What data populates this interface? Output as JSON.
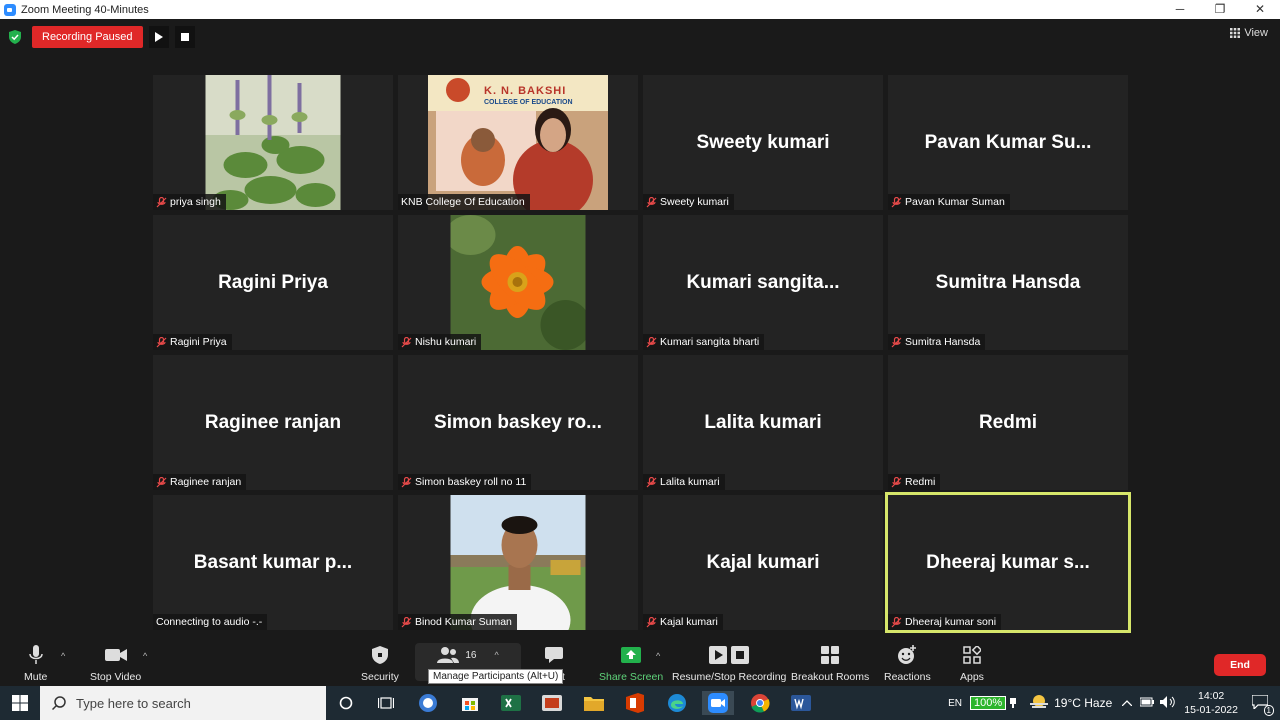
{
  "window": {
    "title": "Zoom Meeting 40-Minutes",
    "controls": [
      "─",
      "❐",
      "✕"
    ]
  },
  "recording": {
    "status": "Recording Paused",
    "resume_icon": "play-icon",
    "stop_icon": "stop-icon"
  },
  "view_button": {
    "label": "View"
  },
  "participants": [
    {
      "display": "",
      "tag": "priya singh",
      "muted": true,
      "media": "tulsi-plant-photo"
    },
    {
      "display": "",
      "tag": "KNB College Of Education",
      "muted": false,
      "media": "video-feed"
    },
    {
      "display": "Sweety kumari",
      "tag": "Sweety kumari",
      "muted": true
    },
    {
      "display": "Pavan Kumar Su...",
      "tag": "Pavan Kumar Suman",
      "muted": true
    },
    {
      "display": "Ragini  Priya",
      "tag": "Ragini  Priya",
      "muted": true
    },
    {
      "display": "",
      "tag": "Nishu kumari",
      "muted": true,
      "media": "orange-flower-photo"
    },
    {
      "display": "Kumari  sangita...",
      "tag": "Kumari sangita bharti",
      "muted": true
    },
    {
      "display": "Sumitra Hansda",
      "tag": "Sumitra Hansda",
      "muted": true
    },
    {
      "display": "Raginee ranjan",
      "tag": "Raginee ranjan",
      "muted": true
    },
    {
      "display": "Simon baskey ro...",
      "tag": "Simon baskey roll no 11",
      "muted": true
    },
    {
      "display": "Lalita kumari",
      "tag": "Lalita kumari",
      "muted": true
    },
    {
      "display": "Redmi",
      "tag": "Redmi",
      "muted": true
    },
    {
      "display": "Basant kumar p...",
      "tag": "Connecting to audio -.-",
      "muted": false
    },
    {
      "display": "",
      "tag": "Binod Kumar Suman",
      "muted": true,
      "media": "man-portrait-photo"
    },
    {
      "display": "Kajal kumari",
      "tag": "Kajal kumari",
      "muted": true
    },
    {
      "display": "Dheeraj  kumar  s...",
      "tag": "Dheeraj kumar soni",
      "muted": true,
      "active_speaker": true
    }
  ],
  "banner": {
    "line1": "K. N. BAKSHI",
    "line2": "COLLEGE OF EDUCATION"
  },
  "toolbar": {
    "mute": "Mute",
    "stop_video": "Stop Video",
    "security": "Security",
    "participants_count": "16",
    "chat_fragment": "t",
    "share_screen": "Share Screen",
    "resume_stop_recording": "Resume/Stop Recording",
    "breakout_rooms": "Breakout Rooms",
    "reactions": "Reactions",
    "apps": "Apps",
    "end": "End",
    "tooltip": "Manage Participants (Alt+U)"
  },
  "taskbar": {
    "search_placeholder": "Type here to search",
    "language": "EN",
    "battery": "100%",
    "weather": "19°C  Haze",
    "time": "14:02",
    "date": "15-01-2022",
    "notification_count": "1"
  },
  "colors": {
    "accent_red": "#e02828",
    "active_border": "#d6e66a",
    "share_green": "#22b14c",
    "zoom_blue": "#2d8cff"
  }
}
